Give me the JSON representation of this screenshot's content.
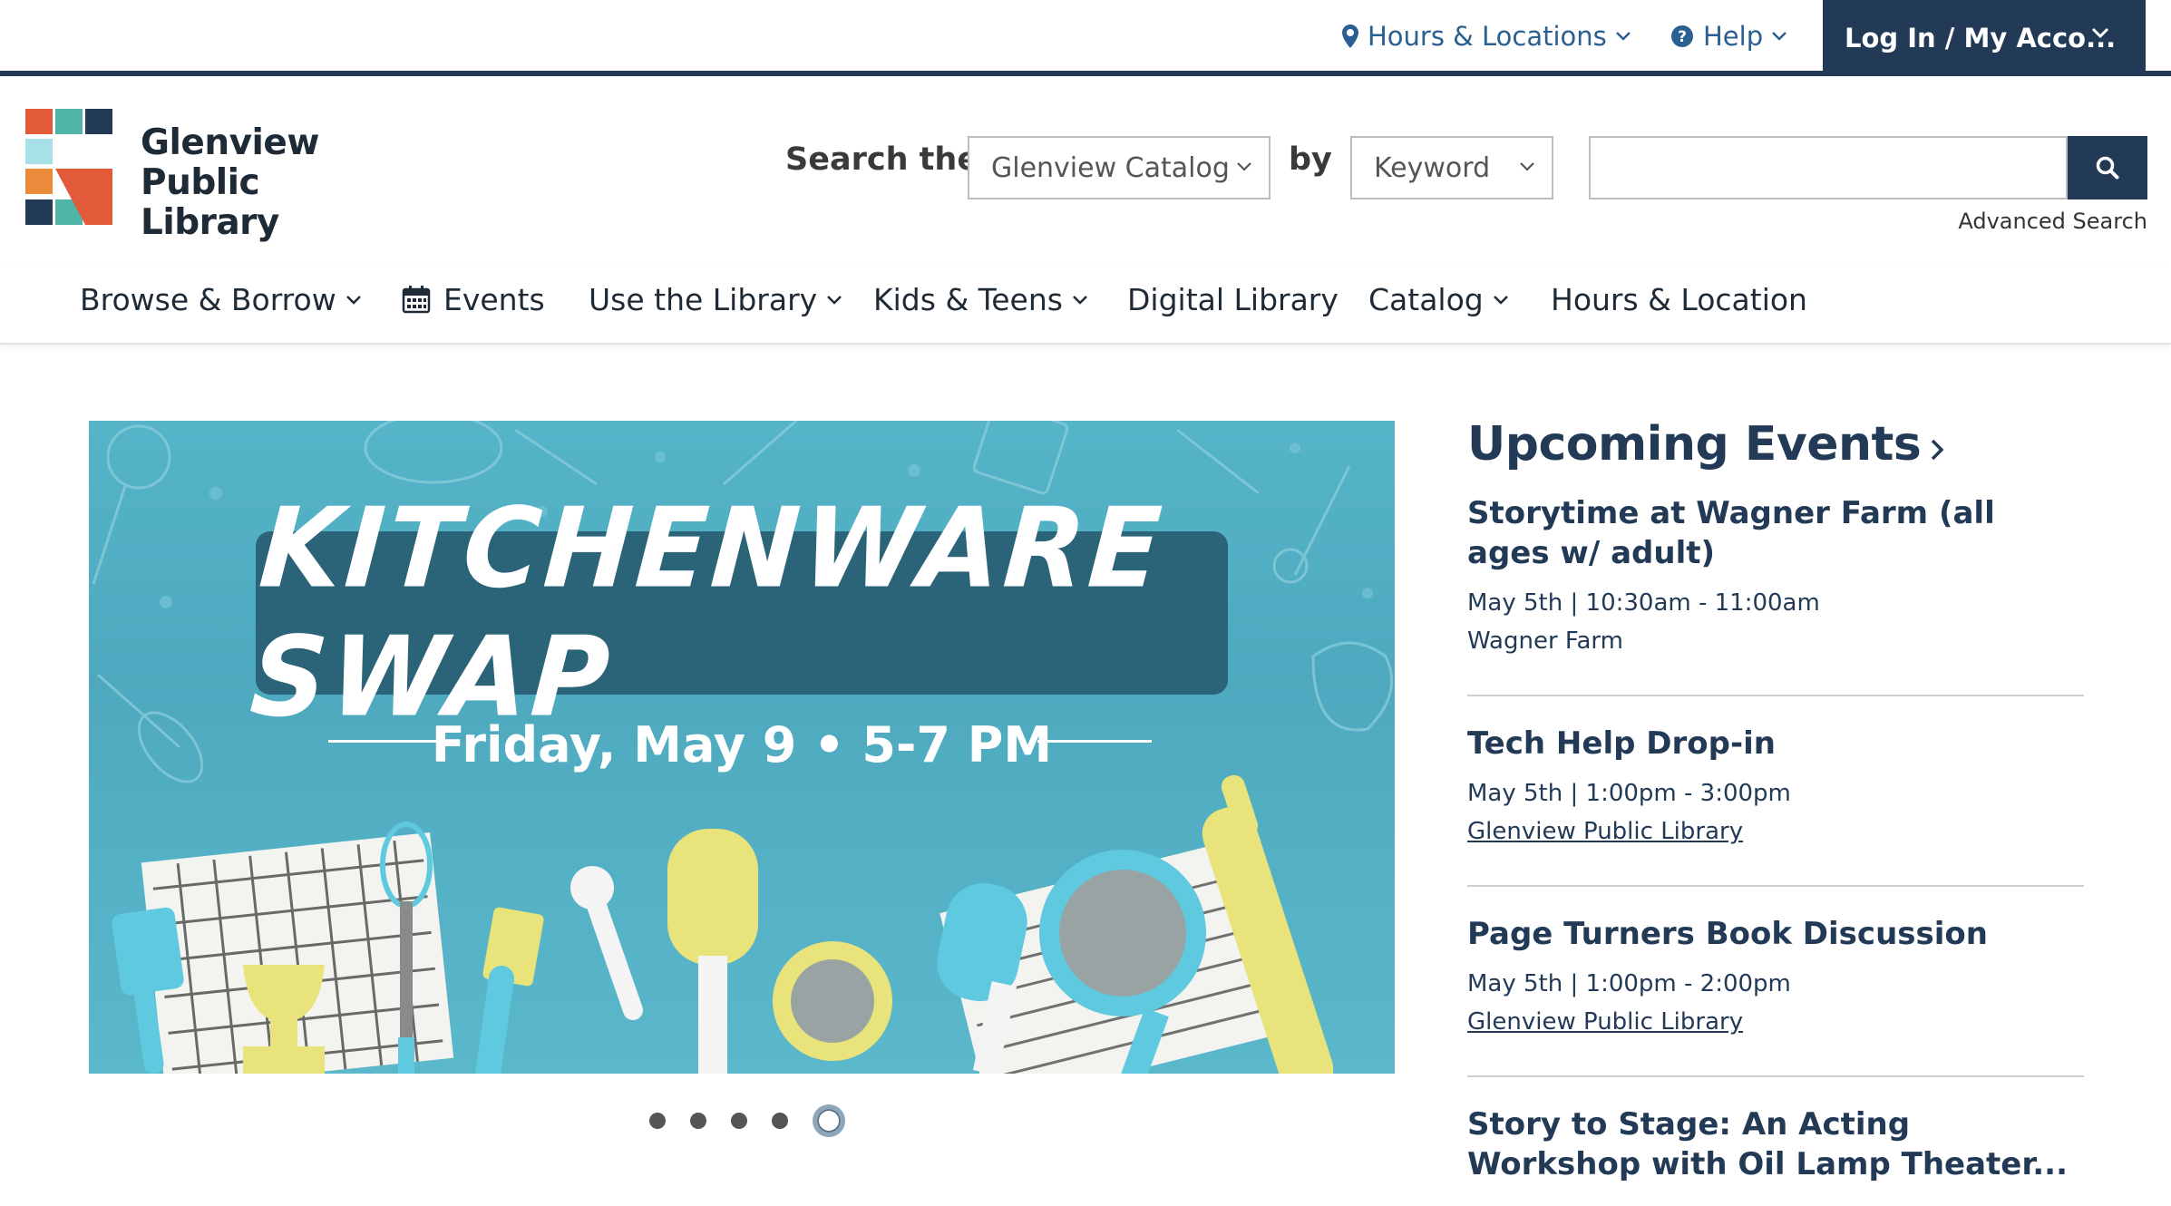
{
  "utility": {
    "hours_locations": "Hours & Locations",
    "help": "Help",
    "login": "Log In / My Acco..."
  },
  "logo": {
    "line1": "Glenview",
    "line2": "Public Library"
  },
  "search": {
    "label": "Search the",
    "scope_value": "Glenview Catalog",
    "by_label": "by",
    "field_value": "Keyword",
    "input_value": "",
    "advanced": "Advanced Search"
  },
  "nav": {
    "items": [
      {
        "label": "Browse & Borrow"
      },
      {
        "label": "Events"
      },
      {
        "label": "Use the Library"
      },
      {
        "label": "Kids & Teens"
      },
      {
        "label": "Digital Library"
      },
      {
        "label": "Catalog"
      },
      {
        "label": "Hours & Location"
      }
    ]
  },
  "hero": {
    "title": "KITCHENWARE SWAP",
    "subtitle": "Friday, May 9 • 5-7 PM",
    "slides_total": 5,
    "active_slide": 5
  },
  "events": {
    "heading": "Upcoming Events",
    "items": [
      {
        "title": "Storytime at Wagner Farm (all ages w/ adult)",
        "time": "May 5th | 10:30am - 11:00am",
        "location": "Wagner Farm"
      },
      {
        "title": "Tech Help Drop-in",
        "time": "May 5th | 1:00pm - 3:00pm",
        "location": "Glenview Public Library"
      },
      {
        "title": "Page Turners Book Discussion",
        "time": "May 5th | 1:00pm - 2:00pm",
        "location": "Glenview Public Library"
      },
      {
        "title": "Story to Stage: An Acting Workshop with Oil Lamp Theater..."
      }
    ]
  },
  "colors": {
    "navy": "#223a56",
    "link_blue": "#2a5f91",
    "hero_teal": "#55b4c8",
    "banner_teal": "#2b6478"
  }
}
